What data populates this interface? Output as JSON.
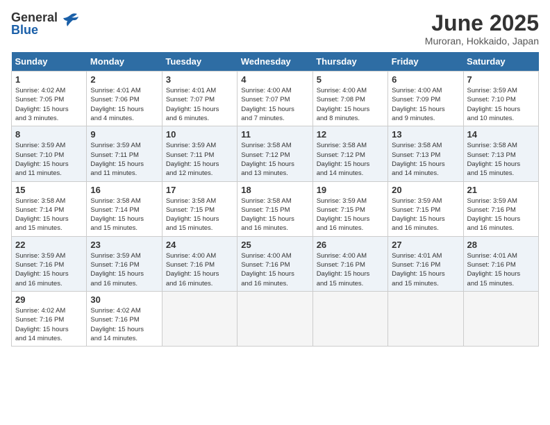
{
  "logo": {
    "general": "General",
    "blue": "Blue"
  },
  "title": "June 2025",
  "subtitle": "Muroran, Hokkaido, Japan",
  "headers": [
    "Sunday",
    "Monday",
    "Tuesday",
    "Wednesday",
    "Thursday",
    "Friday",
    "Saturday"
  ],
  "weeks": [
    [
      {
        "day": "1",
        "info": "Sunrise: 4:02 AM\nSunset: 7:05 PM\nDaylight: 15 hours\nand 3 minutes."
      },
      {
        "day": "2",
        "info": "Sunrise: 4:01 AM\nSunset: 7:06 PM\nDaylight: 15 hours\nand 4 minutes."
      },
      {
        "day": "3",
        "info": "Sunrise: 4:01 AM\nSunset: 7:07 PM\nDaylight: 15 hours\nand 6 minutes."
      },
      {
        "day": "4",
        "info": "Sunrise: 4:00 AM\nSunset: 7:07 PM\nDaylight: 15 hours\nand 7 minutes."
      },
      {
        "day": "5",
        "info": "Sunrise: 4:00 AM\nSunset: 7:08 PM\nDaylight: 15 hours\nand 8 minutes."
      },
      {
        "day": "6",
        "info": "Sunrise: 4:00 AM\nSunset: 7:09 PM\nDaylight: 15 hours\nand 9 minutes."
      },
      {
        "day": "7",
        "info": "Sunrise: 3:59 AM\nSunset: 7:10 PM\nDaylight: 15 hours\nand 10 minutes."
      }
    ],
    [
      {
        "day": "8",
        "info": "Sunrise: 3:59 AM\nSunset: 7:10 PM\nDaylight: 15 hours\nand 11 minutes."
      },
      {
        "day": "9",
        "info": "Sunrise: 3:59 AM\nSunset: 7:11 PM\nDaylight: 15 hours\nand 11 minutes."
      },
      {
        "day": "10",
        "info": "Sunrise: 3:59 AM\nSunset: 7:11 PM\nDaylight: 15 hours\nand 12 minutes."
      },
      {
        "day": "11",
        "info": "Sunrise: 3:58 AM\nSunset: 7:12 PM\nDaylight: 15 hours\nand 13 minutes."
      },
      {
        "day": "12",
        "info": "Sunrise: 3:58 AM\nSunset: 7:12 PM\nDaylight: 15 hours\nand 14 minutes."
      },
      {
        "day": "13",
        "info": "Sunrise: 3:58 AM\nSunset: 7:13 PM\nDaylight: 15 hours\nand 14 minutes."
      },
      {
        "day": "14",
        "info": "Sunrise: 3:58 AM\nSunset: 7:13 PM\nDaylight: 15 hours\nand 15 minutes."
      }
    ],
    [
      {
        "day": "15",
        "info": "Sunrise: 3:58 AM\nSunset: 7:14 PM\nDaylight: 15 hours\nand 15 minutes."
      },
      {
        "day": "16",
        "info": "Sunrise: 3:58 AM\nSunset: 7:14 PM\nDaylight: 15 hours\nand 15 minutes."
      },
      {
        "day": "17",
        "info": "Sunrise: 3:58 AM\nSunset: 7:15 PM\nDaylight: 15 hours\nand 15 minutes."
      },
      {
        "day": "18",
        "info": "Sunrise: 3:58 AM\nSunset: 7:15 PM\nDaylight: 15 hours\nand 16 minutes."
      },
      {
        "day": "19",
        "info": "Sunrise: 3:59 AM\nSunset: 7:15 PM\nDaylight: 15 hours\nand 16 minutes."
      },
      {
        "day": "20",
        "info": "Sunrise: 3:59 AM\nSunset: 7:15 PM\nDaylight: 15 hours\nand 16 minutes."
      },
      {
        "day": "21",
        "info": "Sunrise: 3:59 AM\nSunset: 7:16 PM\nDaylight: 15 hours\nand 16 minutes."
      }
    ],
    [
      {
        "day": "22",
        "info": "Sunrise: 3:59 AM\nSunset: 7:16 PM\nDaylight: 15 hours\nand 16 minutes."
      },
      {
        "day": "23",
        "info": "Sunrise: 3:59 AM\nSunset: 7:16 PM\nDaylight: 15 hours\nand 16 minutes."
      },
      {
        "day": "24",
        "info": "Sunrise: 4:00 AM\nSunset: 7:16 PM\nDaylight: 15 hours\nand 16 minutes."
      },
      {
        "day": "25",
        "info": "Sunrise: 4:00 AM\nSunset: 7:16 PM\nDaylight: 15 hours\nand 16 minutes."
      },
      {
        "day": "26",
        "info": "Sunrise: 4:00 AM\nSunset: 7:16 PM\nDaylight: 15 hours\nand 15 minutes."
      },
      {
        "day": "27",
        "info": "Sunrise: 4:01 AM\nSunset: 7:16 PM\nDaylight: 15 hours\nand 15 minutes."
      },
      {
        "day": "28",
        "info": "Sunrise: 4:01 AM\nSunset: 7:16 PM\nDaylight: 15 hours\nand 15 minutes."
      }
    ],
    [
      {
        "day": "29",
        "info": "Sunrise: 4:02 AM\nSunset: 7:16 PM\nDaylight: 15 hours\nand 14 minutes."
      },
      {
        "day": "30",
        "info": "Sunrise: 4:02 AM\nSunset: 7:16 PM\nDaylight: 15 hours\nand 14 minutes."
      },
      null,
      null,
      null,
      null,
      null
    ]
  ]
}
